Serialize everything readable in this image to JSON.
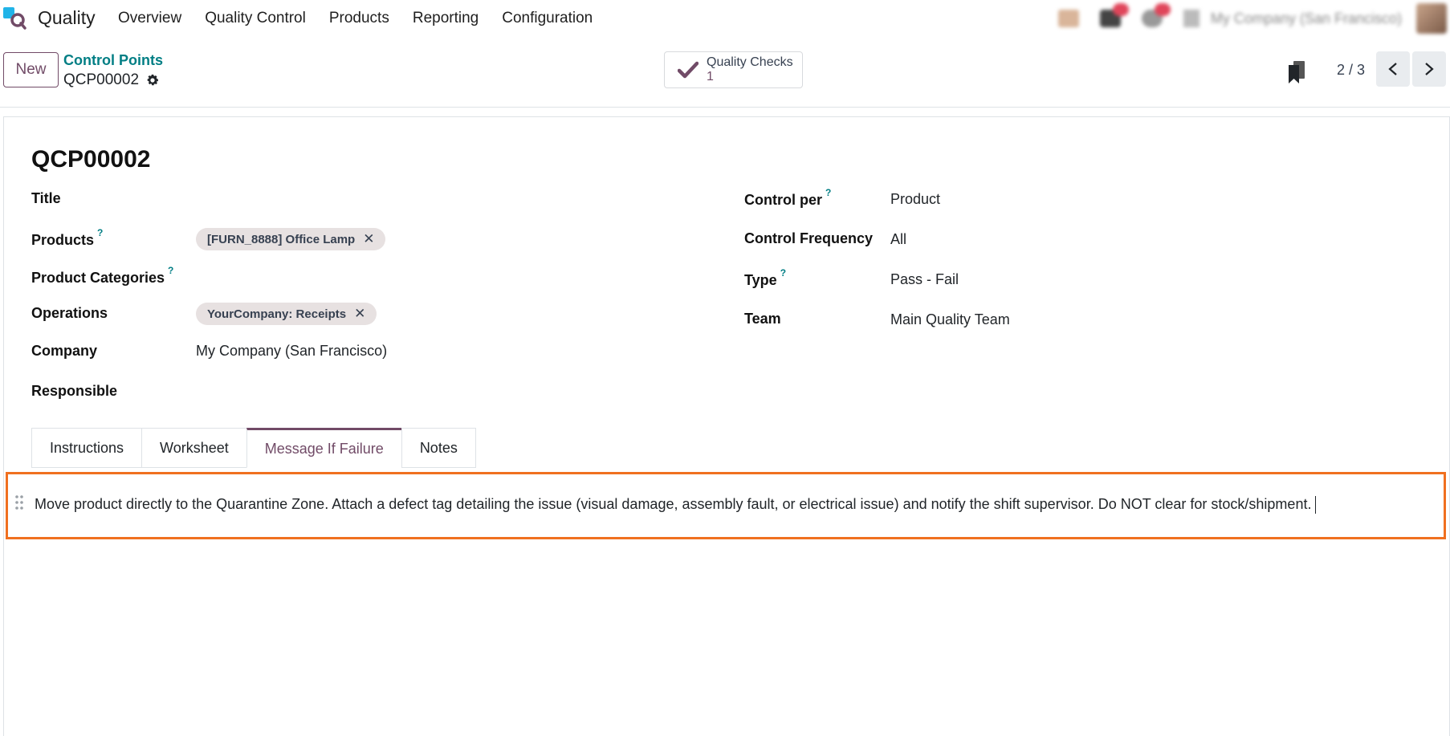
{
  "navbar": {
    "app_name": "Quality",
    "menu": [
      "Overview",
      "Quality Control",
      "Products",
      "Reporting",
      "Configuration"
    ],
    "company": "My Company (San Francisco)"
  },
  "control_panel": {
    "new_label": "New",
    "breadcrumb": "Control Points",
    "record_name": "QCP00002",
    "smart_button": {
      "label": "Quality Checks",
      "count": "1"
    },
    "pager": "2 / 3"
  },
  "form": {
    "title": "QCP00002",
    "left": {
      "title_label": "Title",
      "products_label": "Products",
      "products_tag": "[FURN_8888] Office Lamp",
      "product_categories_label": "Product Categories",
      "operations_label": "Operations",
      "operations_tag": "YourCompany: Receipts",
      "company_label": "Company",
      "company_value": "My Company (San Francisco)",
      "responsible_label": "Responsible"
    },
    "right": {
      "control_per_label": "Control per",
      "control_per_value": "Product",
      "control_frequency_label": "Control Frequency",
      "control_frequency_value": "All",
      "type_label": "Type",
      "type_value": "Pass - Fail",
      "team_label": "Team",
      "team_value": "Main Quality Team"
    },
    "help_mark": "?",
    "tabs": [
      "Instructions",
      "Worksheet",
      "Message If Failure",
      "Notes"
    ],
    "active_tab": "Message If Failure",
    "failure_message": "Move product directly to the Quarantine Zone. Attach a defect tag detailing the issue (visual damage, assembly fault, or electrical issue) and notify the shift supervisor. Do NOT clear for stock/shipment."
  },
  "colors": {
    "brand": "#714b67",
    "link": "#017e84",
    "highlight": "#f07020"
  }
}
